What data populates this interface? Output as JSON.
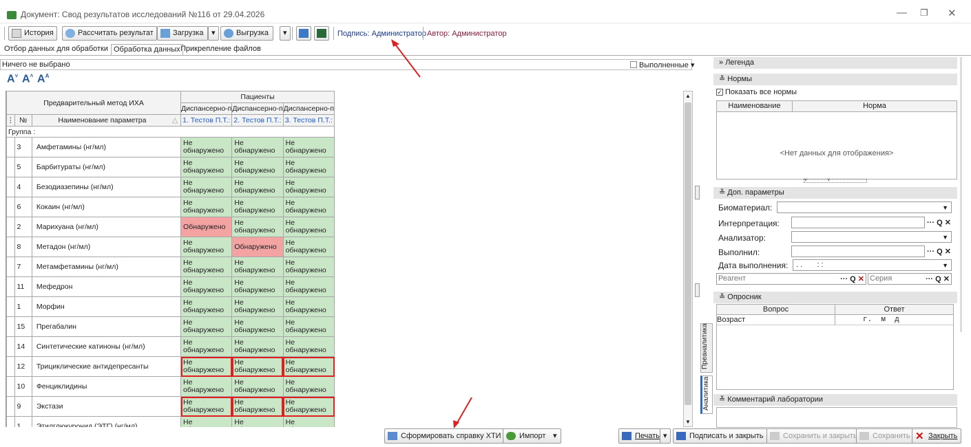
{
  "window": {
    "title": "Документ: Свод результатов исследований №116 от 29.04.2026"
  },
  "toolbar": {
    "history": "История",
    "calc": "Рассчитать результат",
    "load": "Загрузка",
    "unload": "Выгрузка",
    "sign_label": "Подпись: Администратор",
    "author_label": "Автор: Администратор"
  },
  "tabs": [
    "Отбор данных для обработки",
    "Обработка данных",
    "Прикрепление файлов"
  ],
  "selection": {
    "text": "Ничего не выбрано",
    "filter": "Выполненные"
  },
  "grid": {
    "method_header": "Предварительный метод ИХА",
    "patients_header": "Пациенты",
    "col_group": [
      "Диспансерно-п",
      "Диспансерно-п",
      "Диспансерно-п"
    ],
    "col_patient": [
      "1. Тестов П.Т.:",
      "2. Тестов П.Т.:",
      "3. Тестов П.Т.:"
    ],
    "num_header": "№",
    "name_header": "Наименование параметра",
    "group_label": "Группа :",
    "rows": [
      {
        "num": "3",
        "name": "Амфетамины (нг/мл)",
        "r": [
          "Не обнаружено",
          "Не обнаружено",
          "Не обнаружено"
        ]
      },
      {
        "num": "5",
        "name": "Барбитураты (нг/мл)",
        "r": [
          "Не обнаружено",
          "Не обнаружено",
          "Не обнаружено"
        ]
      },
      {
        "num": "4",
        "name": "Безодиазепины (нг/мл)",
        "r": [
          "Не обнаружено",
          "Не обнаружено",
          "Не обнаружено"
        ]
      },
      {
        "num": "6",
        "name": "Кокаин (нг/мл)",
        "r": [
          "Не обнаружено",
          "Не обнаружено",
          "Не обнаружено"
        ]
      },
      {
        "num": "2",
        "name": "Марихуана (нг/мл)",
        "r": [
          "Обнаружено",
          "Не обнаружено",
          "Не обнаружено"
        ]
      },
      {
        "num": "8",
        "name": "Метадон (нг/мл)",
        "r": [
          "Не обнаружено",
          "Обнаружено",
          "Не обнаружено"
        ]
      },
      {
        "num": "7",
        "name": "Метамфетамины (нг/мл)",
        "r": [
          "Не обнаружено",
          "Не обнаружено",
          "Не обнаружено"
        ]
      },
      {
        "num": "11",
        "name": "Мефедрон",
        "r": [
          "Не обнаружено",
          "Не обнаружено",
          "Не обнаружено"
        ]
      },
      {
        "num": "1",
        "name": "Морфин",
        "r": [
          "Не обнаружено",
          "Не обнаружено",
          "Не обнаружено"
        ]
      },
      {
        "num": "15",
        "name": "Прегабалин",
        "r": [
          "Не обнаружено",
          "Не обнаружено",
          "Не обнаружено"
        ]
      },
      {
        "num": "14",
        "name": "Синтетические катиноны (нг/мл)",
        "r": [
          "Не обнаружено",
          "Не обнаружено",
          "Не обнаружено"
        ]
      },
      {
        "num": "12",
        "name": "Трициклические антидепресанты",
        "r": [
          "Не обнаружено",
          "Не обнаружено",
          "Не обнаружено"
        ]
      },
      {
        "num": "10",
        "name": "Фенциклидины",
        "r": [
          "Не обнаружено",
          "Не обнаружено",
          "Не обнаружено"
        ]
      },
      {
        "num": "9",
        "name": "Экстази",
        "r": [
          "Не обнаружено",
          "Не обнаружено",
          "Не обнаружено"
        ]
      },
      {
        "num": "1",
        "name": "Этилглюкуронид (ЭТГ) (нг/мл)",
        "r": [
          "Не обнаружено",
          "Не обнаружено",
          "Не обнаружено"
        ]
      }
    ]
  },
  "right": {
    "legend": "Легенда",
    "norms": "Нормы",
    "show_all": "Показать все нормы",
    "norm_cols": [
      "Наименование",
      "Норма"
    ],
    "no_data": "<Нет данных для отображения>",
    "extra": "Доп. параметры",
    "biomaterial": "Биоматериал:",
    "interp": "Интерпретация:",
    "analyzer": "Анализатор:",
    "performed": "Выполнил:",
    "date": "Дата выполнения:",
    "date_val": ". .       : :",
    "reagent": "Реагент",
    "series": "Серия",
    "survey": "Опросник",
    "survey_cols": [
      "Вопрос",
      "Ответ"
    ],
    "age": "Возраст",
    "age_units": "г.  м  д",
    "comment": "Комментарий лаборатории",
    "tab_pre": "Преаналитика",
    "tab_an": "Аналитика"
  },
  "bottom": {
    "make_cert": "Сформировать справку ХТИ",
    "import": "Импорт",
    "print": "Печать",
    "sign_close": "Подписать и закрыть",
    "save_close": "Сохранить и закрыть",
    "save": "Сохранить",
    "close": "Закрыть"
  }
}
